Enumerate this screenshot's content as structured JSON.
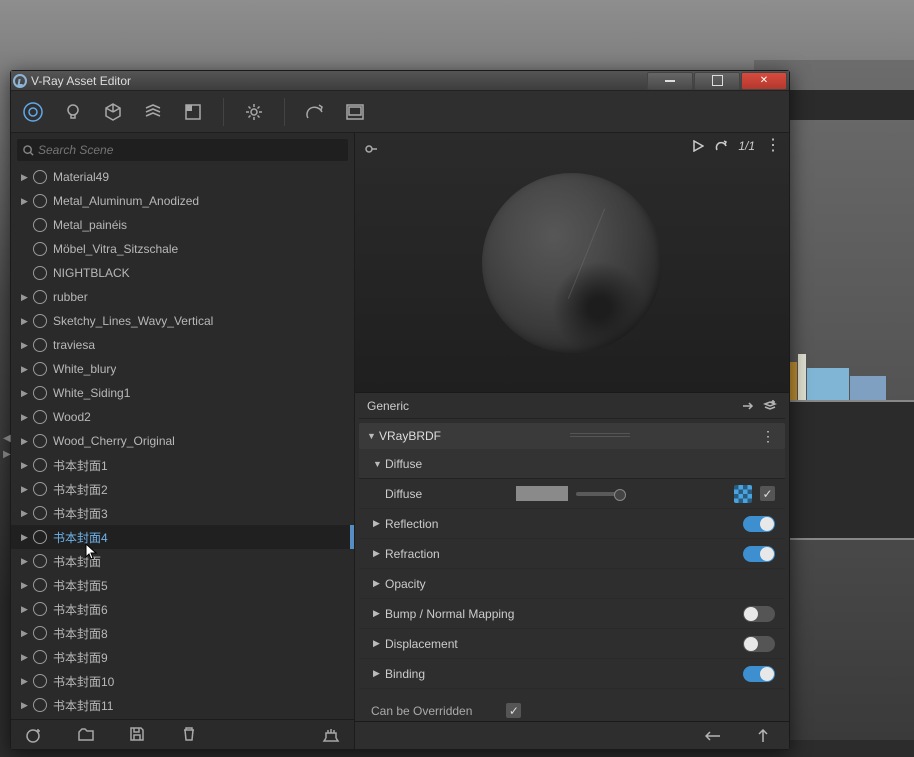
{
  "window": {
    "title": "V-Ray Asset Editor"
  },
  "search": {
    "placeholder": "Search Scene"
  },
  "materials": [
    {
      "name": "Material49",
      "expandable": true
    },
    {
      "name": "Metal_Aluminum_Anodized",
      "expandable": true
    },
    {
      "name": "Metal_painéis",
      "expandable": false
    },
    {
      "name": "Möbel_Vitra_Sitzschale",
      "expandable": false
    },
    {
      "name": "NIGHTBLACK",
      "expandable": false
    },
    {
      "name": "rubber",
      "expandable": true
    },
    {
      "name": "Sketchy_Lines_Wavy_Vertical",
      "expandable": true
    },
    {
      "name": "traviesa",
      "expandable": true
    },
    {
      "name": "White_blury",
      "expandable": true
    },
    {
      "name": "White_Siding1",
      "expandable": true
    },
    {
      "name": "Wood2",
      "expandable": true
    },
    {
      "name": "Wood_Cherry_Original",
      "expandable": true
    },
    {
      "name": "书本封面1",
      "expandable": true
    },
    {
      "name": "书本封面2",
      "expandable": true
    },
    {
      "name": "书本封面3",
      "expandable": true
    },
    {
      "name": "书本封面4",
      "expandable": true,
      "selected": true
    },
    {
      "name": "书本封面",
      "expandable": true
    },
    {
      "name": "书本封面5",
      "expandable": true
    },
    {
      "name": "书本封面6",
      "expandable": true
    },
    {
      "name": "书本封面8",
      "expandable": true
    },
    {
      "name": "书本封面9",
      "expandable": true
    },
    {
      "name": "书本封面10",
      "expandable": true
    },
    {
      "name": "书本封面11",
      "expandable": true
    }
  ],
  "preview": {
    "counter": "1/1"
  },
  "properties": {
    "materialType": "Generic",
    "brdf": "VRayBRDF",
    "sections": [
      {
        "name": "Diffuse",
        "expanded": true
      },
      {
        "name": "Reflection",
        "toggle": true,
        "on": true
      },
      {
        "name": "Refraction",
        "toggle": true,
        "on": true
      },
      {
        "name": "Opacity",
        "toggle": false
      },
      {
        "name": "Bump / Normal Mapping",
        "toggle": true,
        "on": false
      },
      {
        "name": "Displacement",
        "toggle": true,
        "on": false
      },
      {
        "name": "Binding",
        "toggle": true,
        "on": true
      }
    ],
    "diffuse": {
      "label": "Diffuse",
      "color": "#8a8a8a",
      "hasTexture": true,
      "checked": true
    },
    "override": {
      "label": "Can be Overridden",
      "checked": true
    }
  }
}
